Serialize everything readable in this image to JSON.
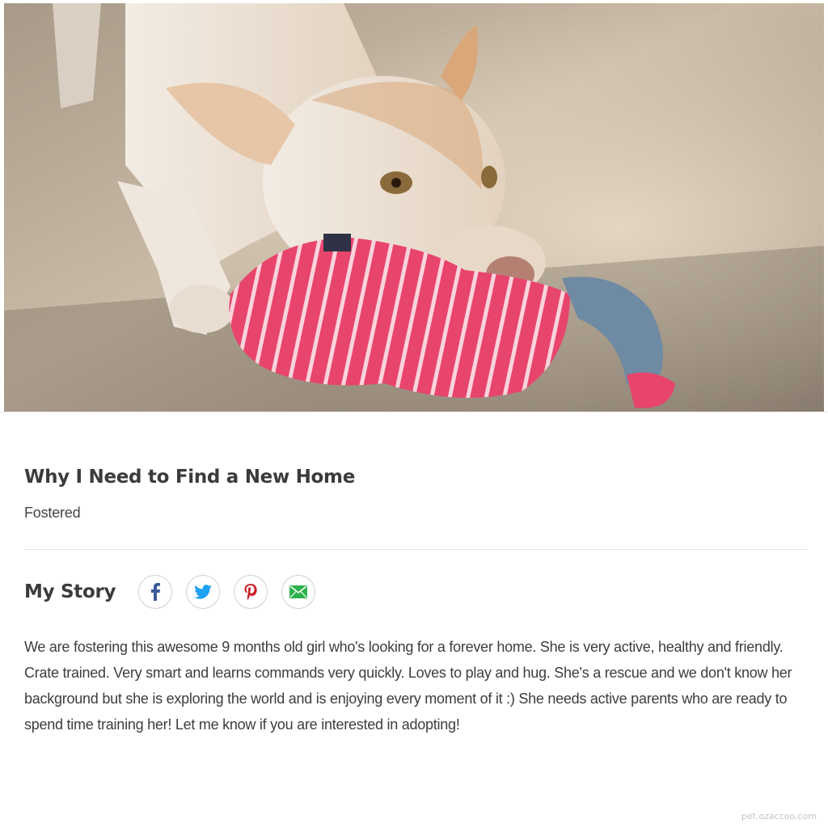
{
  "photo": {
    "alt": "Dog chewing pink striped toy"
  },
  "section": {
    "title": "Why I Need to Find a New Home",
    "status": "Fostered"
  },
  "story": {
    "title": "My Story",
    "share_buttons": [
      {
        "icon": "facebook-icon",
        "color": "#3b5998"
      },
      {
        "icon": "twitter-icon",
        "color": "#1da1f2"
      },
      {
        "icon": "pinterest-icon",
        "color": "#cb2027"
      },
      {
        "icon": "email-icon",
        "color": "#2bb24c"
      }
    ],
    "body": "We are fostering this awesome 9 months old girl who's looking for a forever home. She is very active, healthy and friendly. Crate trained. Very smart and learns commands very quickly. Loves to play and hug. She's a rescue and we don't know her background but she is exploring the world and is enjoying every moment of it :) She needs active parents who are ready to spend time training her! Let me know if you are interested in adopting!"
  },
  "watermark": "pet.ozaccoo.com"
}
